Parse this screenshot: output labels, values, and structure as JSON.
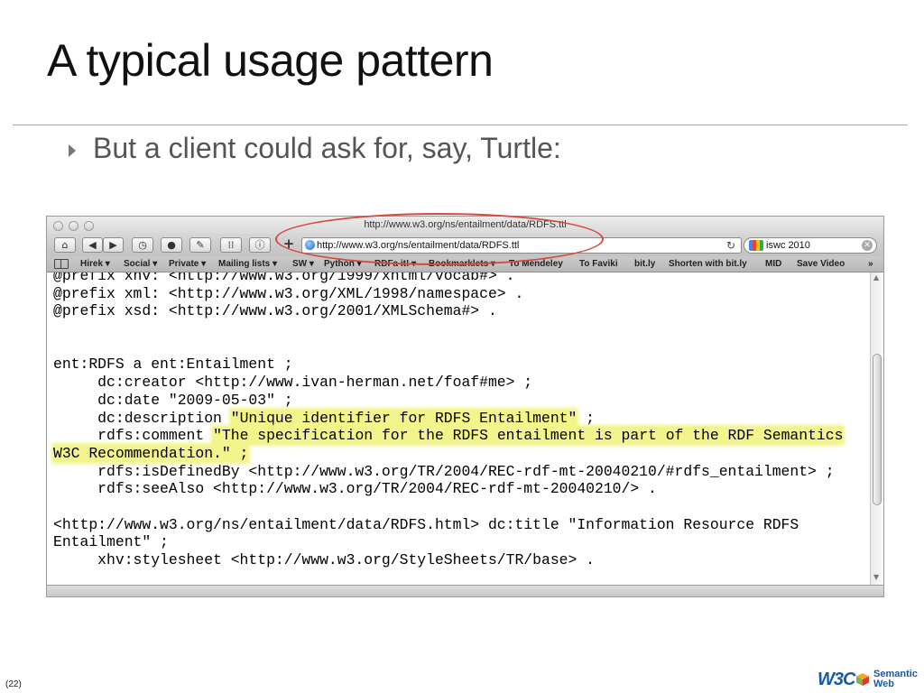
{
  "slide": {
    "title": "A typical usage pattern",
    "bullet": "But a client could ask for, say, Turtle:",
    "slide_number": "(22)"
  },
  "browser": {
    "window_title": "http://www.w3.org/ns/entailment/data/RDFS.ttl",
    "url": "http://www.w3.org/ns/entailment/data/RDFS.ttl",
    "search_value": "iswc 2010",
    "bookmarks": [
      "Hirek ▾",
      "Social ▾",
      "Private ▾",
      "Mailing lists ▾",
      "SW ▾",
      "Python ▾",
      "RDFa it! ▾",
      "Bookmarklets ▾",
      "To Mendeley",
      "To Faviki",
      "bit.ly",
      "Shorten with bit.ly",
      "MID",
      "Save Video",
      "»"
    ],
    "code_lines": [
      "@prefix xhv: <http://www.w3.org/1999/xhtml/vocab#> .",
      "@prefix xml: <http://www.w3.org/XML/1998/namespace> .",
      "@prefix xsd: <http://www.w3.org/2001/XMLSchema#> .",
      "",
      "",
      "ent:RDFS a ent:Entailment ;",
      "     dc:creator <http://www.ivan-herman.net/foaf#me> ;",
      "     dc:date \"2009-05-03\" ;",
      "     dc:description ",
      "     rdfs:comment ",
      "",
      "     rdfs:isDefinedBy <http://www.w3.org/TR/2004/REC-rdf-mt-20040210/#rdfs_entailment> ;",
      "     rdfs:seeAlso <http://www.w3.org/TR/2004/REC-rdf-mt-20040210/> .",
      "",
      "<http://www.w3.org/ns/entailment/data/RDFS.html> dc:title \"Information Resource RDFS",
      "Entailment\" ;",
      "     xhv:stylesheet <http://www.w3.org/StyleSheets/TR/base> ."
    ],
    "highlights": {
      "description_value": "\"Unique identifier for RDFS Entailment\"",
      "description_tail": " ;",
      "comment_value": "\"The specification for the RDFS entailment is part of the RDF Semantics",
      "comment_value_cont": "W3C Recommendation.\" ;"
    }
  },
  "footer": {
    "w3c": "W3C",
    "semantic": "Semantic",
    "web": "Web"
  },
  "colors": {
    "highlight": "#f3f58c",
    "annotation_ellipse": "#d24b3e",
    "w3c_blue": "#1a5aa5"
  }
}
